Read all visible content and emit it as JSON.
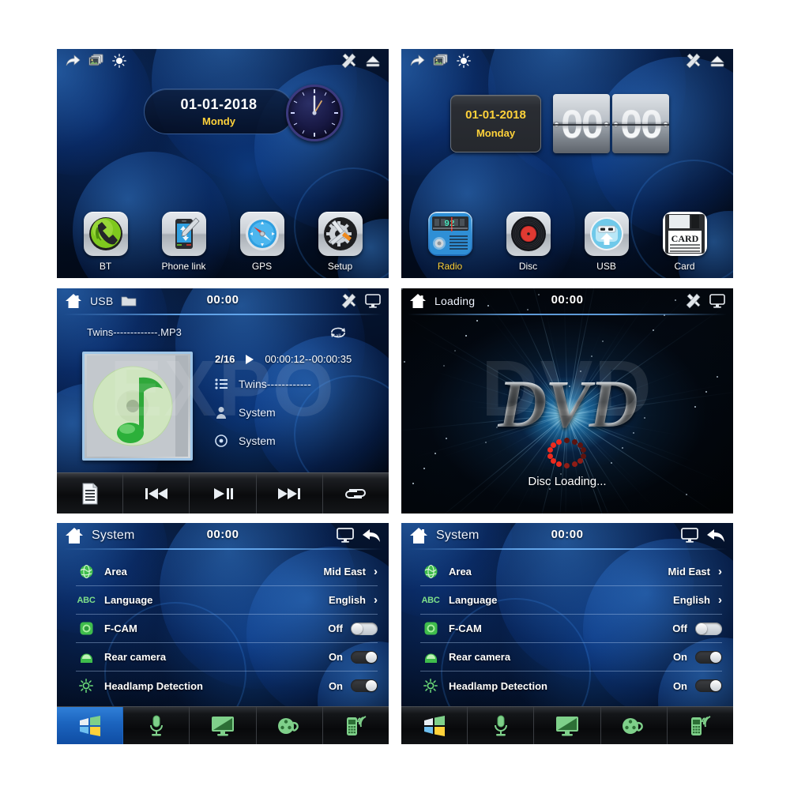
{
  "meta": {
    "accent_blue": "#1b63bd",
    "accent_yellow": "#ffd23a",
    "green": "#7fe08a"
  },
  "panels": {
    "home_analog": {
      "toolbar": {
        "share_icon": "share-arrow-icon",
        "gallery_icon": "gallery-icon",
        "brightness_icon": "brightness-icon",
        "tools_icon": "tools-icon",
        "eject_icon": "eject-icon"
      },
      "date": "01-01-2018",
      "weekday": "Mondy",
      "apps": [
        {
          "label": "BT",
          "icon": "bluetooth-phone-icon",
          "highlight": false
        },
        {
          "label": "Phone link",
          "icon": "phone-link-icon",
          "highlight": false
        },
        {
          "label": "GPS",
          "icon": "gps-compass-icon",
          "highlight": false
        },
        {
          "label": "Setup",
          "icon": "setup-gear-icon",
          "highlight": false
        }
      ]
    },
    "home_flip": {
      "toolbar": {
        "share_icon": "share-arrow-icon",
        "gallery_icon": "gallery-icon",
        "brightness_icon": "brightness-icon",
        "tools_icon": "tools-icon",
        "eject_icon": "eject-icon"
      },
      "date": "01-01-2018",
      "weekday": "Monday",
      "clock_hours": "00",
      "clock_minutes": "00",
      "apps": [
        {
          "label": "Radio",
          "icon": "radio-icon",
          "highlight": true
        },
        {
          "label": "Disc",
          "icon": "vinyl-disc-icon",
          "highlight": false
        },
        {
          "label": "USB",
          "icon": "usb-icon",
          "highlight": false
        },
        {
          "label": "Card",
          "icon": "sd-card-icon",
          "highlight": false
        }
      ]
    },
    "music": {
      "header": {
        "home_icon": "home-icon",
        "source": "USB",
        "folder_icon": "folder-icon",
        "clock": "00:00",
        "tools_icon": "tools-icon",
        "screen_icon": "monitor-icon"
      },
      "file_name": "Twins-------------.MP3",
      "repeat_icon": "repeat-all-icon",
      "track_index": "2/16",
      "play_icon": "play-icon",
      "time": "00:00:12--00:00:35",
      "meta": [
        {
          "icon": "list-icon",
          "text": "Twins------------"
        },
        {
          "icon": "artist-icon",
          "text": "System"
        },
        {
          "icon": "album-icon",
          "text": "System"
        }
      ],
      "controls": [
        {
          "icon": "playlist-icon",
          "name": "playlist-button"
        },
        {
          "icon": "previous-icon",
          "name": "previous-button"
        },
        {
          "icon": "play-pause-icon",
          "name": "play-pause-button"
        },
        {
          "icon": "next-icon",
          "name": "next-button"
        },
        {
          "icon": "repeat-icon",
          "name": "repeat-button"
        }
      ]
    },
    "dvd": {
      "header": {
        "home_icon": "home-icon",
        "title": "Loading",
        "clock": "00:00",
        "tools_icon": "tools-icon",
        "screen_icon": "monitor-icon"
      },
      "logo": "DVD",
      "watermark": "DVD",
      "status": "Disc Loading..."
    },
    "system_a": {
      "header": {
        "home_icon": "home-icon",
        "title": "System",
        "clock": "00:00",
        "screen_icon": "monitor-icon",
        "back_icon": "back-arrow-icon"
      },
      "rows": [
        {
          "icon": "globe-icon",
          "label": "Area",
          "value": "Mid East",
          "control": "chevron",
          "chevron": "›"
        },
        {
          "icon": "abc-icon",
          "label": "Language",
          "value": "English",
          "control": "chevron",
          "chevron": "›"
        },
        {
          "icon": "fcam-icon",
          "label": "F-CAM",
          "value": "Off",
          "control": "toggle",
          "state": "off"
        },
        {
          "icon": "rearcam-icon",
          "label": "Rear camera",
          "value": "On",
          "control": "toggle",
          "state": "on"
        },
        {
          "icon": "headlamp-icon",
          "label": "Headlamp Detection",
          "value": "On",
          "control": "toggle",
          "state": "on"
        }
      ],
      "navbar": [
        {
          "icon": "windows-icon",
          "name": "nav-system",
          "active": true
        },
        {
          "icon": "microphone-icon",
          "name": "nav-voice",
          "active": false
        },
        {
          "icon": "monitor-icon",
          "name": "nav-display",
          "active": false
        },
        {
          "icon": "film-reel-icon",
          "name": "nav-video",
          "active": false
        },
        {
          "icon": "cellphone-icon",
          "name": "nav-phone",
          "active": false
        }
      ]
    },
    "system_b": {
      "header": {
        "home_icon": "home-icon",
        "title": "System",
        "clock": "00:00",
        "screen_icon": "monitor-icon",
        "back_icon": "back-arrow-icon"
      },
      "rows": [
        {
          "icon": "globe-icon",
          "label": "Area",
          "value": "Mid East",
          "control": "chevron",
          "chevron": "›"
        },
        {
          "icon": "abc-icon",
          "label": "Language",
          "value": "English",
          "control": "chevron",
          "chevron": "›"
        },
        {
          "icon": "fcam-icon",
          "label": "F-CAM",
          "value": "Off",
          "control": "toggle",
          "state": "off"
        },
        {
          "icon": "rearcam-icon",
          "label": "Rear camera",
          "value": "On",
          "control": "toggle",
          "state": "on"
        },
        {
          "icon": "headlamp-icon",
          "label": "Headlamp Detection",
          "value": "On",
          "control": "toggle",
          "state": "on"
        }
      ],
      "navbar": [
        {
          "icon": "windows-icon",
          "name": "nav-system",
          "active": false
        },
        {
          "icon": "microphone-icon",
          "name": "nav-voice",
          "active": false
        },
        {
          "icon": "monitor-icon",
          "name": "nav-display",
          "active": false
        },
        {
          "icon": "film-reel-icon",
          "name": "nav-video",
          "active": false
        },
        {
          "icon": "cellphone-icon",
          "name": "nav-phone",
          "active": false
        }
      ]
    }
  }
}
